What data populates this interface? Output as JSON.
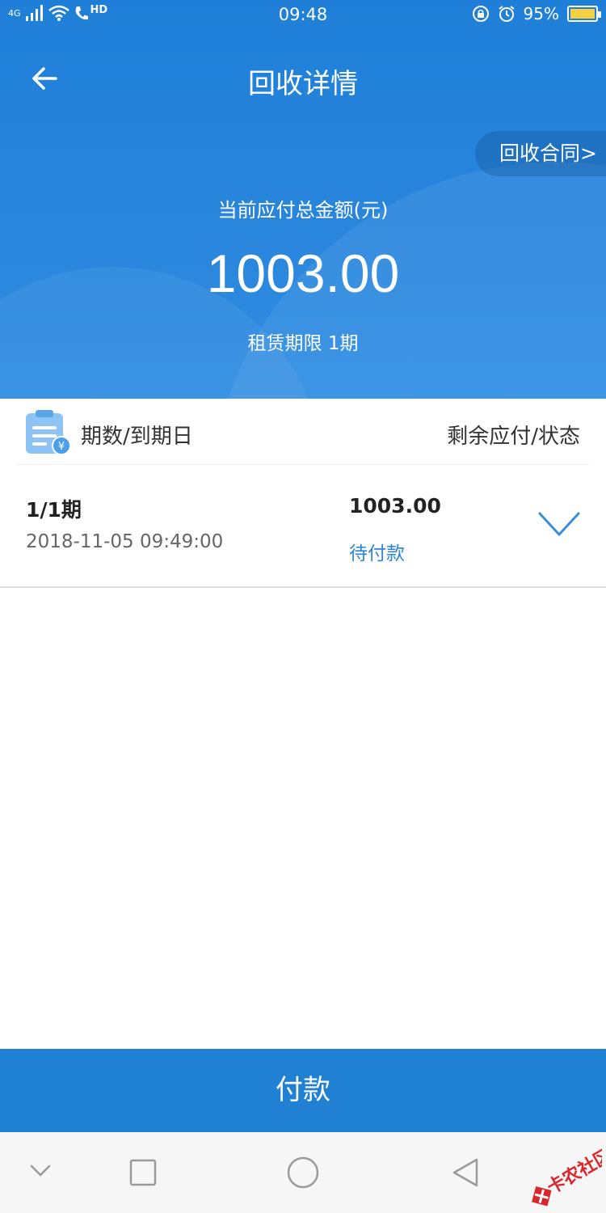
{
  "status_bar": {
    "network": "4G",
    "hd": "HD",
    "time": "09:48",
    "battery_percent": "95%"
  },
  "nav": {
    "title": "回收详情"
  },
  "header": {
    "contract_link": "回收合同>",
    "amount_label": "当前应付总金额(元)",
    "amount_value": "1003.00",
    "lease_term": "租赁期限 1期"
  },
  "table": {
    "header_left": "期数/到期日",
    "header_right": "剩余应付/状态",
    "rows": [
      {
        "period": "1/1期",
        "due_date": "2018-11-05 09:49:00",
        "remaining": "1003.00",
        "status": "待付款"
      }
    ]
  },
  "footer": {
    "pay_label": "付款"
  },
  "watermark": {
    "text": "卡农社区"
  },
  "colors": {
    "primary": "#1f80d4",
    "status_pending": "#2b86d9"
  }
}
